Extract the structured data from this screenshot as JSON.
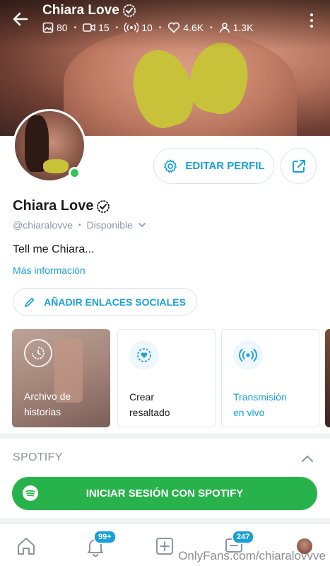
{
  "header": {
    "name": "Chiara Love",
    "stats": [
      {
        "icon": "image-icon",
        "value": "80"
      },
      {
        "icon": "video-icon",
        "value": "15"
      },
      {
        "icon": "broadcast-icon",
        "value": "10"
      },
      {
        "icon": "heart-icon",
        "value": "4.6K"
      },
      {
        "icon": "user-icon",
        "value": "1.3K"
      }
    ]
  },
  "actions": {
    "edit_profile": "EDITAR PERFIL"
  },
  "profile": {
    "name": "Chiara Love",
    "handle": "@chiaralovve",
    "status": "Disponible",
    "bio": "Tell me Chiara...",
    "more_info": "Más información",
    "add_social_links": "AÑADIR ENLACES SOCIALES"
  },
  "highlights": [
    {
      "label_line1": "Archivo de",
      "label_line2": "historias"
    },
    {
      "label_line1": "Crear",
      "label_line2": "resaltado"
    },
    {
      "label_line1": "Transmisión",
      "label_line2": "en vivo"
    }
  ],
  "spotify": {
    "heading": "SPOTIFY",
    "login_button": "INICIAR SESIÓN CON SPOTIFY"
  },
  "bottom_nav": {
    "notifications_badge": "99+",
    "messages_badge": "247"
  },
  "watermark": "OnlyFans.com/chiaralovvve",
  "colors": {
    "accent": "#1aa0d8",
    "online": "#2ec45a",
    "spotify": "#28b24b"
  }
}
